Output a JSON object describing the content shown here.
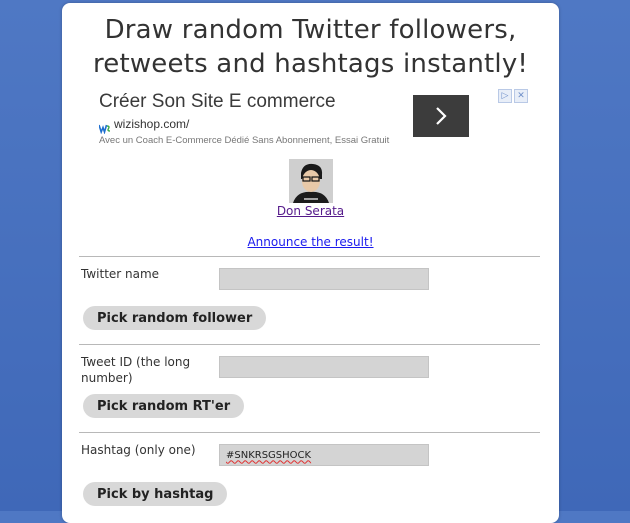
{
  "title_line1": "Draw random Twitter followers,",
  "title_line2": "retweets and hashtags instantly!",
  "ad": {
    "headline": "Créer Son Site E commerce",
    "url": "wizishop.com/",
    "description": "Avec un Coach E-Commerce Dédié Sans Abonnement, Essai Gratuit",
    "logo_icon": "wizishop-logo-icon",
    "arrow_icon": "chevron-right-icon",
    "choices_icons": [
      "adchoices-play-icon",
      "close-icon"
    ]
  },
  "user": {
    "name": "Don Serata",
    "avatar_icon": "user-avatar"
  },
  "announce_link": "Announce the result!",
  "sections": {
    "follower": {
      "label": "Twitter name",
      "value": "",
      "button": "Pick random follower"
    },
    "retweet": {
      "label": "Tweet ID (the long number)",
      "value": "",
      "button": "Pick random RT'er"
    },
    "hashtag": {
      "label": "Hashtag (only one)",
      "value": "#SNKRSGSHOCK",
      "button": "Pick by hashtag"
    }
  },
  "colors": {
    "background": "#4a73c0",
    "card": "#ffffff",
    "visited_link": "#551a8b",
    "link": "#1a1aee",
    "button": "#d8d8d8",
    "input": "#d4d4d4"
  }
}
